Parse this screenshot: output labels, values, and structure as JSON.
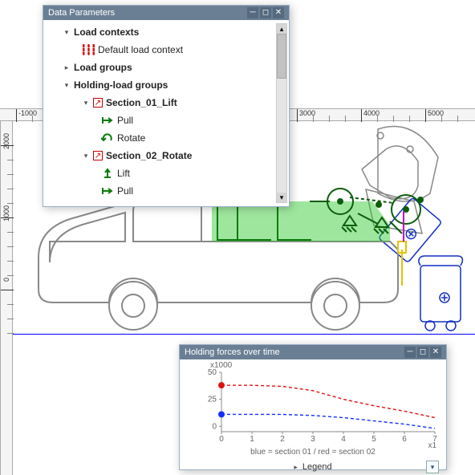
{
  "panels": {
    "data_parameters": {
      "title": "Data Parameters",
      "tree": {
        "load_contexts": "Load contexts",
        "default_load_context": "Default load context",
        "load_groups": "Load groups",
        "holding_load_groups": "Holding-load groups",
        "section_01": "Section_01_Lift",
        "section_02": "Section_02_Rotate",
        "lift": "Lift",
        "pull": "Pull",
        "rotate": "Rotate"
      }
    },
    "chart": {
      "title": "Holding forces over time",
      "y_unit": "x1000",
      "x_unit": "x1",
      "caption": "blue = section 01 / red = section 02"
    }
  },
  "legend": {
    "label": "Legend"
  },
  "ruler": {
    "h": {
      "neg1000": "-1000",
      "p3000": "3000",
      "p4000": "4000",
      "p5000": "5000"
    },
    "v": {
      "p2000": "2000",
      "p1000": "1000",
      "zero": "0"
    }
  },
  "chart_data": {
    "type": "line",
    "x": [
      0,
      1,
      2,
      3,
      4,
      5,
      6,
      7
    ],
    "series": [
      {
        "name": "section 01 (blue)",
        "color": "#1030ff",
        "values": [
          11,
          11,
          11,
          10,
          8,
          5,
          2,
          -2
        ]
      },
      {
        "name": "section 02 (red)",
        "color": "#e01010",
        "values": [
          38,
          38,
          37,
          33,
          25,
          19,
          14,
          8
        ]
      }
    ],
    "markers": [
      {
        "series": "red",
        "x": 0,
        "y": 38
      },
      {
        "series": "blue",
        "x": 0,
        "y": 11
      }
    ],
    "xlabel": "x1",
    "ylabel": "x1000",
    "xlim": [
      0,
      7
    ],
    "ylim": [
      -5,
      50
    ],
    "xticks": [
      0,
      1,
      2,
      3,
      4,
      5,
      6,
      7
    ],
    "yticks": [
      0,
      25,
      50
    ],
    "title": "Holding forces over time"
  }
}
